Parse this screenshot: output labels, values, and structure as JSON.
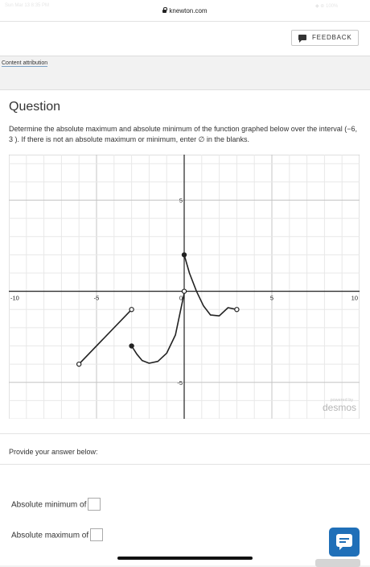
{
  "browser": {
    "url": "knewton.com",
    "status_left": "Sun Mar 13 8:35 PM",
    "status_right": "◆ ⊕ 100%"
  },
  "feedback": {
    "label": "FEEDBACK"
  },
  "attribution": {
    "label": "Content attribution"
  },
  "question": {
    "title": "Question",
    "prompt": "Determine the absolute maximum and absolute minimum of the function graphed below over the interval (−6, 3 ). If there is not an absolute maximum or minimum, enter ∅ in the blanks."
  },
  "chart_data": {
    "type": "line",
    "xlim": [
      -10,
      10
    ],
    "ylim": [
      -7,
      7.5
    ],
    "grid": true,
    "x_ticks": [
      {
        "value": -10,
        "label": "-10"
      },
      {
        "value": -5,
        "label": "-5"
      },
      {
        "value": 0,
        "label": "0"
      },
      {
        "value": 5,
        "label": "5"
      },
      {
        "value": 10,
        "label": "10"
      }
    ],
    "y_ticks": [
      {
        "value": 5,
        "label": "5"
      },
      {
        "value": -5,
        "label": "-5"
      }
    ],
    "series": [
      {
        "points": [
          [
            -6,
            -4
          ],
          [
            -3,
            -1
          ]
        ]
      },
      {
        "points": [
          [
            -3,
            -3
          ],
          [
            -2.7,
            -3.45
          ],
          [
            -2.4,
            -3.8
          ],
          [
            -2,
            -3.95
          ],
          [
            -1.5,
            -3.85
          ],
          [
            -1,
            -3.4
          ],
          [
            -0.5,
            -2.4
          ],
          [
            0,
            -0.1
          ]
        ]
      },
      {
        "points": [
          [
            0,
            2
          ],
          [
            0.3,
            1.0
          ],
          [
            0.7,
            0
          ],
          [
            1.1,
            -0.8
          ],
          [
            1.5,
            -1.3
          ],
          [
            2,
            -1.35
          ],
          [
            2.5,
            -0.9
          ],
          [
            3,
            -1
          ]
        ]
      }
    ],
    "endpoints": [
      {
        "x": -6,
        "y": -4,
        "filled": false
      },
      {
        "x": -3,
        "y": -1,
        "filled": false
      },
      {
        "x": -3,
        "y": -3,
        "filled": true
      },
      {
        "x": 0,
        "y": 2,
        "filled": true
      },
      {
        "x": 0,
        "y": 0,
        "filled": false
      },
      {
        "x": 3,
        "y": -1,
        "filled": false
      }
    ],
    "watermark_top": "powered by",
    "watermark": "desmos"
  },
  "answer": {
    "provide_label": "Provide your answer below:",
    "min_label": "Absolute minimum of",
    "max_label": "Absolute maximum of"
  },
  "colors": {
    "accent": "#1f6fb8"
  }
}
